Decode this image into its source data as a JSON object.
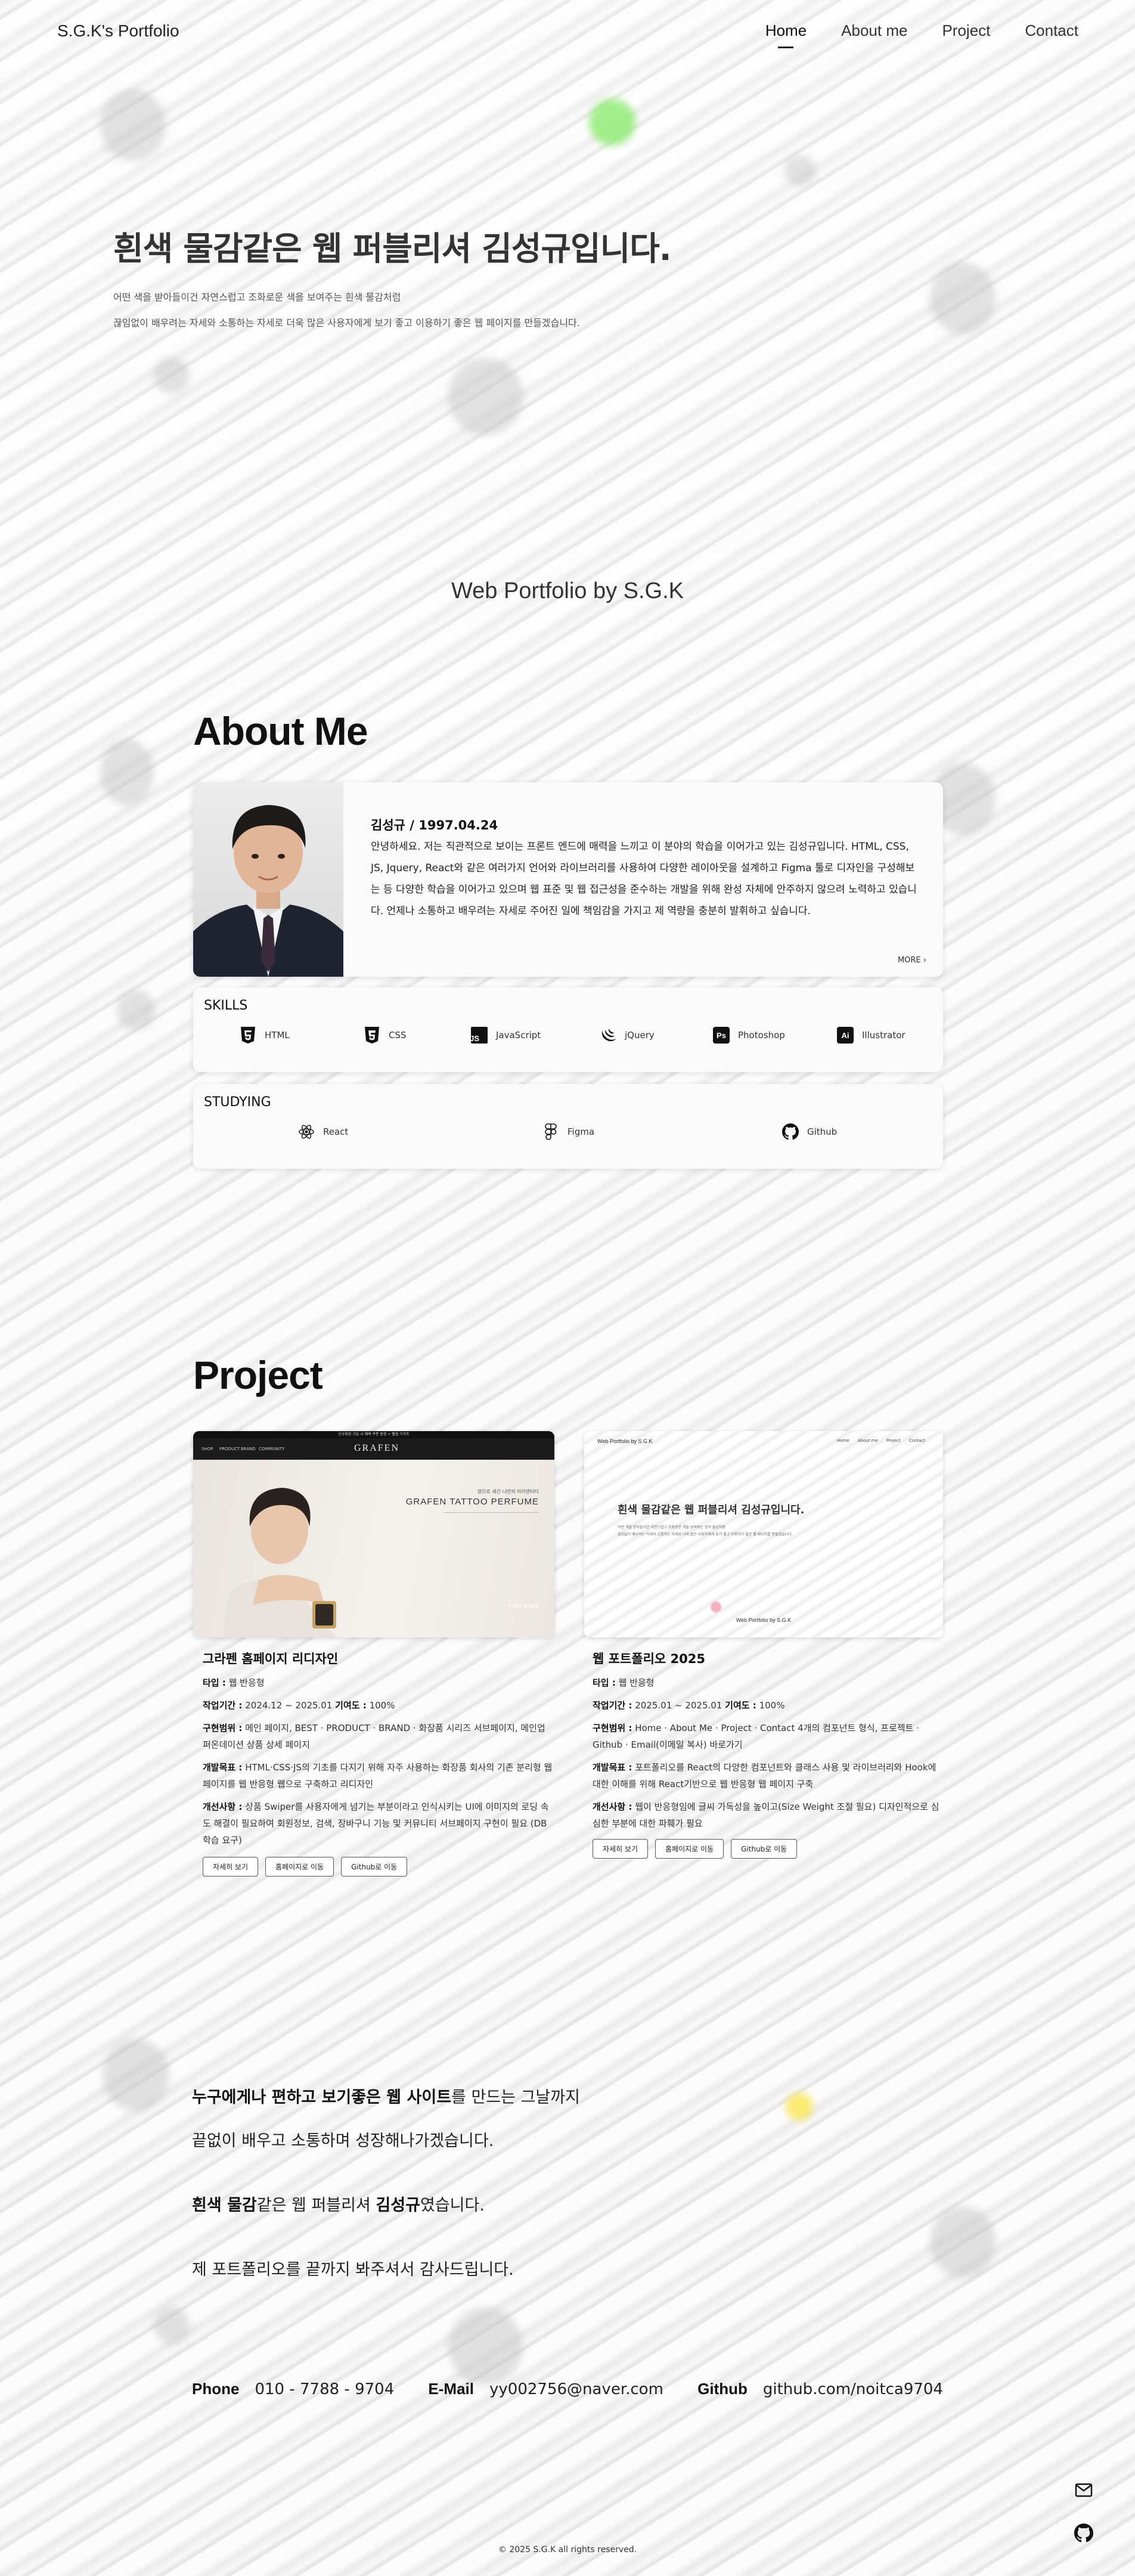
{
  "header": {
    "logo": "S.G.K's Portfolio",
    "nav": [
      "Home",
      "About me",
      "Project",
      "Contact"
    ]
  },
  "hero": {
    "title": "흰색 물감같은 웹 퍼블리셔 김성규입니다.",
    "line1": "어떤 색을 받아들이건 자연스럽고 조화로운 색을 보여주는 흰색 물감처럼",
    "line2": "끊임없이 배우려는 자세와 소통하는 자세로 더욱 많은 사용자에게 보기 좋고 이용하기 좋은 웹 페이지를 만들겠습니다."
  },
  "site_caption": "Web Portfolio by S.G.K",
  "about": {
    "title": "About Me",
    "name": "김성규 / 1997.04.24",
    "body": "안녕하세요. 저는 직관적으로 보이는 프론트 엔드에 매력을 느끼고 이 분야의 학습을 이어가고 있는 김성규입니다. HTML, CSS, JS, Jquery, React와 같은 여러가지 언어와 라이브러리를 사용하여 다양한 레이아웃을 설계하고 Figma 툴로 디자인을 구성해보는 등 다양한 학습을 이어가고 있으며 웹 표준 및 웹 접근성을 준수하는 개발을 위해 완성 자체에 안주하지 않으려 노력하고 있습니다. 언제나 소통하고 배우려는 자세로 주어진 일에 책임감을 가지고 제 역량을 충분히 발휘하고 싶습니다.",
    "more": "MORE",
    "skills_title": "SKILLS",
    "skills": [
      {
        "icon": "html5-icon",
        "label": "HTML"
      },
      {
        "icon": "css3-icon",
        "label": "CSS"
      },
      {
        "icon": "javascript-icon",
        "label": "JavaScript"
      },
      {
        "icon": "jquery-icon",
        "label": "jQuery"
      },
      {
        "icon": "photoshop-icon",
        "label": "Photoshop"
      },
      {
        "icon": "illustrator-icon",
        "label": "Illustrator"
      }
    ],
    "studying_title": "STUDYING",
    "studying": [
      {
        "icon": "react-icon",
        "label": "React"
      },
      {
        "icon": "figma-icon",
        "label": "Figma"
      },
      {
        "icon": "github-icon",
        "label": "Github"
      }
    ]
  },
  "project": {
    "title": "Project",
    "items": [
      {
        "title": "그라펜 홈페이지 리디자인",
        "type_label": "타입 :",
        "type": "웹 반응형",
        "period_label": "작업기간 :",
        "period": "2024.12 ~ 2025.01",
        "contrib_label": "기여도 :",
        "contrib": "100%",
        "scope_label": "구현범위 :",
        "scope": "메인 페이지, BEST · PRODUCT · BRAND · 화장품 시리즈 서브페이지, 메인업 퍼온데이션 상품 상세 페이지",
        "goal_label": "개발목표 :",
        "goal": "HTML·CSS·JS의 기초를 다지기 위해 자주 사용하는 화장품 회사의 기존 분리형 웹페이지를 웹 반응형 웹으로 구축하고 리디자인",
        "improve_label": "개선사항 :",
        "improve": "상품 Swiper를 사용자에게 넘기는 부분이라고 인식시키는 UI에 이미지의 로딩 속도 해결이 필요하여 회원정보, 검색, 장바구니 기능 및 커뮤니티 서브페이지 구현이 필요 (DB 학습 요구)",
        "buttons": [
          "자세히 보기",
          "홈페이지로 이동",
          "Github로 이동"
        ],
        "shot": {
          "banner": "신규회원 가입 시 혜택 쿠폰 증정 + 웰컴 기프트",
          "menu": [
            "SHOP",
            "PRODUCT",
            "BRAND",
            "COMMUNITY"
          ],
          "logo": "GRAFEN",
          "kicker": "향으로 새긴 나만의 아이덴티티",
          "headline": "GRAFEN TATTOO PERFUME",
          "caption": "FIND MORE"
        }
      },
      {
        "title": "웹 포트폴리오 2025",
        "type_label": "타입 :",
        "type": "웹 반응형",
        "period_label": "작업기간 :",
        "period": "2025.01 ~ 2025.01",
        "contrib_label": "기여도 :",
        "contrib": "100%",
        "scope_label": "구현범위 :",
        "scope": "Home · About Me · Project · Contact 4개의 컴포넌트 형식, 프로젝트 · Github · Email(이메일 복사) 바로가기",
        "goal_label": "개발목표 :",
        "goal": "포트폴리오를 React의 다양한 컴포넌트와 클래스 사용 및 라이브러리와 Hook에 대한 이해를 위해 React기반으로 웹 반응형 웹 페이지 구축",
        "improve_label": "개선사항 :",
        "improve": "웹이 반응형임에 글씨 가독성을 높이고(Size Weight 조절 필요) 디자인적으로 심심한 부분에 대한 파훼가 필요",
        "buttons": [
          "자세히 보기",
          "홈페이지로 이동",
          "Github로 이동"
        ],
        "shot": {
          "logo": "Web Portfolio by S.G.K",
          "menu": [
            "Home",
            "About me",
            "Project",
            "Contact"
          ],
          "headline": "흰색 물감같은 웹 퍼블리셔 김성규입니다.",
          "line1": "어떤 색을 받아들이건 자연스럽고 조화로운 색을 보여주는 흰색 물감처럼",
          "line2": "끊임없이 배우려는 자세와 소통하는 자세로 더욱 많은 사용자에게 보기 좋고 이용하기 좋은 웹 페이지를 만들겠습니다.",
          "caption": "Web Portfolio by S.G.K"
        }
      }
    ]
  },
  "closing": {
    "l1_b1": "누구에게나 편하고 보기좋은 웹 사이트",
    "l1_rest": "를 만드는 그날까지",
    "l2": "끝없이 배우고 소통하며 성장해나가겠습니다.",
    "l3_b1": "흰색 물감",
    "l3_mid": "같은 웹 퍼블리셔 ",
    "l3_b2": "김성규",
    "l3_rest": "였습니다.",
    "l4": "제 포트폴리오를 끝까지 봐주셔서 감사드립니다."
  },
  "contact": {
    "phone_label": "Phone",
    "phone": "010 - 7788 - 9704",
    "email_label": "E-Mail",
    "email": "yy002756@naver.com",
    "github_label": "Github",
    "github": "github.com/noitca9704"
  },
  "footer": "© 2025 S.G.K all rights reserved."
}
